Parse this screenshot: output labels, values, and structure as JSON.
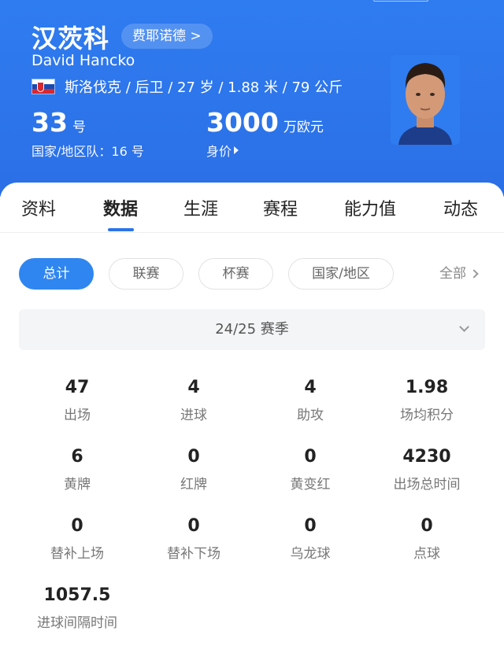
{
  "player": {
    "name_cn": "汉茨科",
    "club_link": "费耶诺德 >",
    "name_en": "David Hancko",
    "info": "斯洛伐克 / 后卫 / 27 岁 / 1.88 米 / 79 公斤",
    "shirt_number": "33",
    "shirt_unit": "号",
    "national_team": "国家/地区队：16 号",
    "market_value": "3000",
    "market_value_unit": "万欧元",
    "market_value_label": "身价"
  },
  "icons": {
    "flag": "slovakia-flag-icon",
    "photo": "player-photo"
  },
  "tabs": [
    "资料",
    "数据",
    "生涯",
    "赛程",
    "能力值",
    "动态"
  ],
  "active_tab": "数据",
  "filters": {
    "chips": [
      "总计",
      "联赛",
      "杯赛",
      "国家/地区"
    ],
    "active": "总计",
    "all_label": "全部"
  },
  "season": "24/25 赛季",
  "stats": [
    {
      "value": "47",
      "label": "出场"
    },
    {
      "value": "4",
      "label": "进球"
    },
    {
      "value": "4",
      "label": "助攻"
    },
    {
      "value": "1.98",
      "label": "场均积分"
    },
    {
      "value": "6",
      "label": "黄牌"
    },
    {
      "value": "0",
      "label": "红牌"
    },
    {
      "value": "0",
      "label": "黄变红"
    },
    {
      "value": "4230",
      "label": "出场总时间"
    },
    {
      "value": "0",
      "label": "替补上场"
    },
    {
      "value": "0",
      "label": "替补下场"
    },
    {
      "value": "0",
      "label": "乌龙球"
    },
    {
      "value": "0",
      "label": "点球"
    },
    {
      "value": "1057.5",
      "label": "进球间隔时间"
    }
  ],
  "colors": {
    "header": "#2f7cf0",
    "accent": "#2f86f0"
  }
}
